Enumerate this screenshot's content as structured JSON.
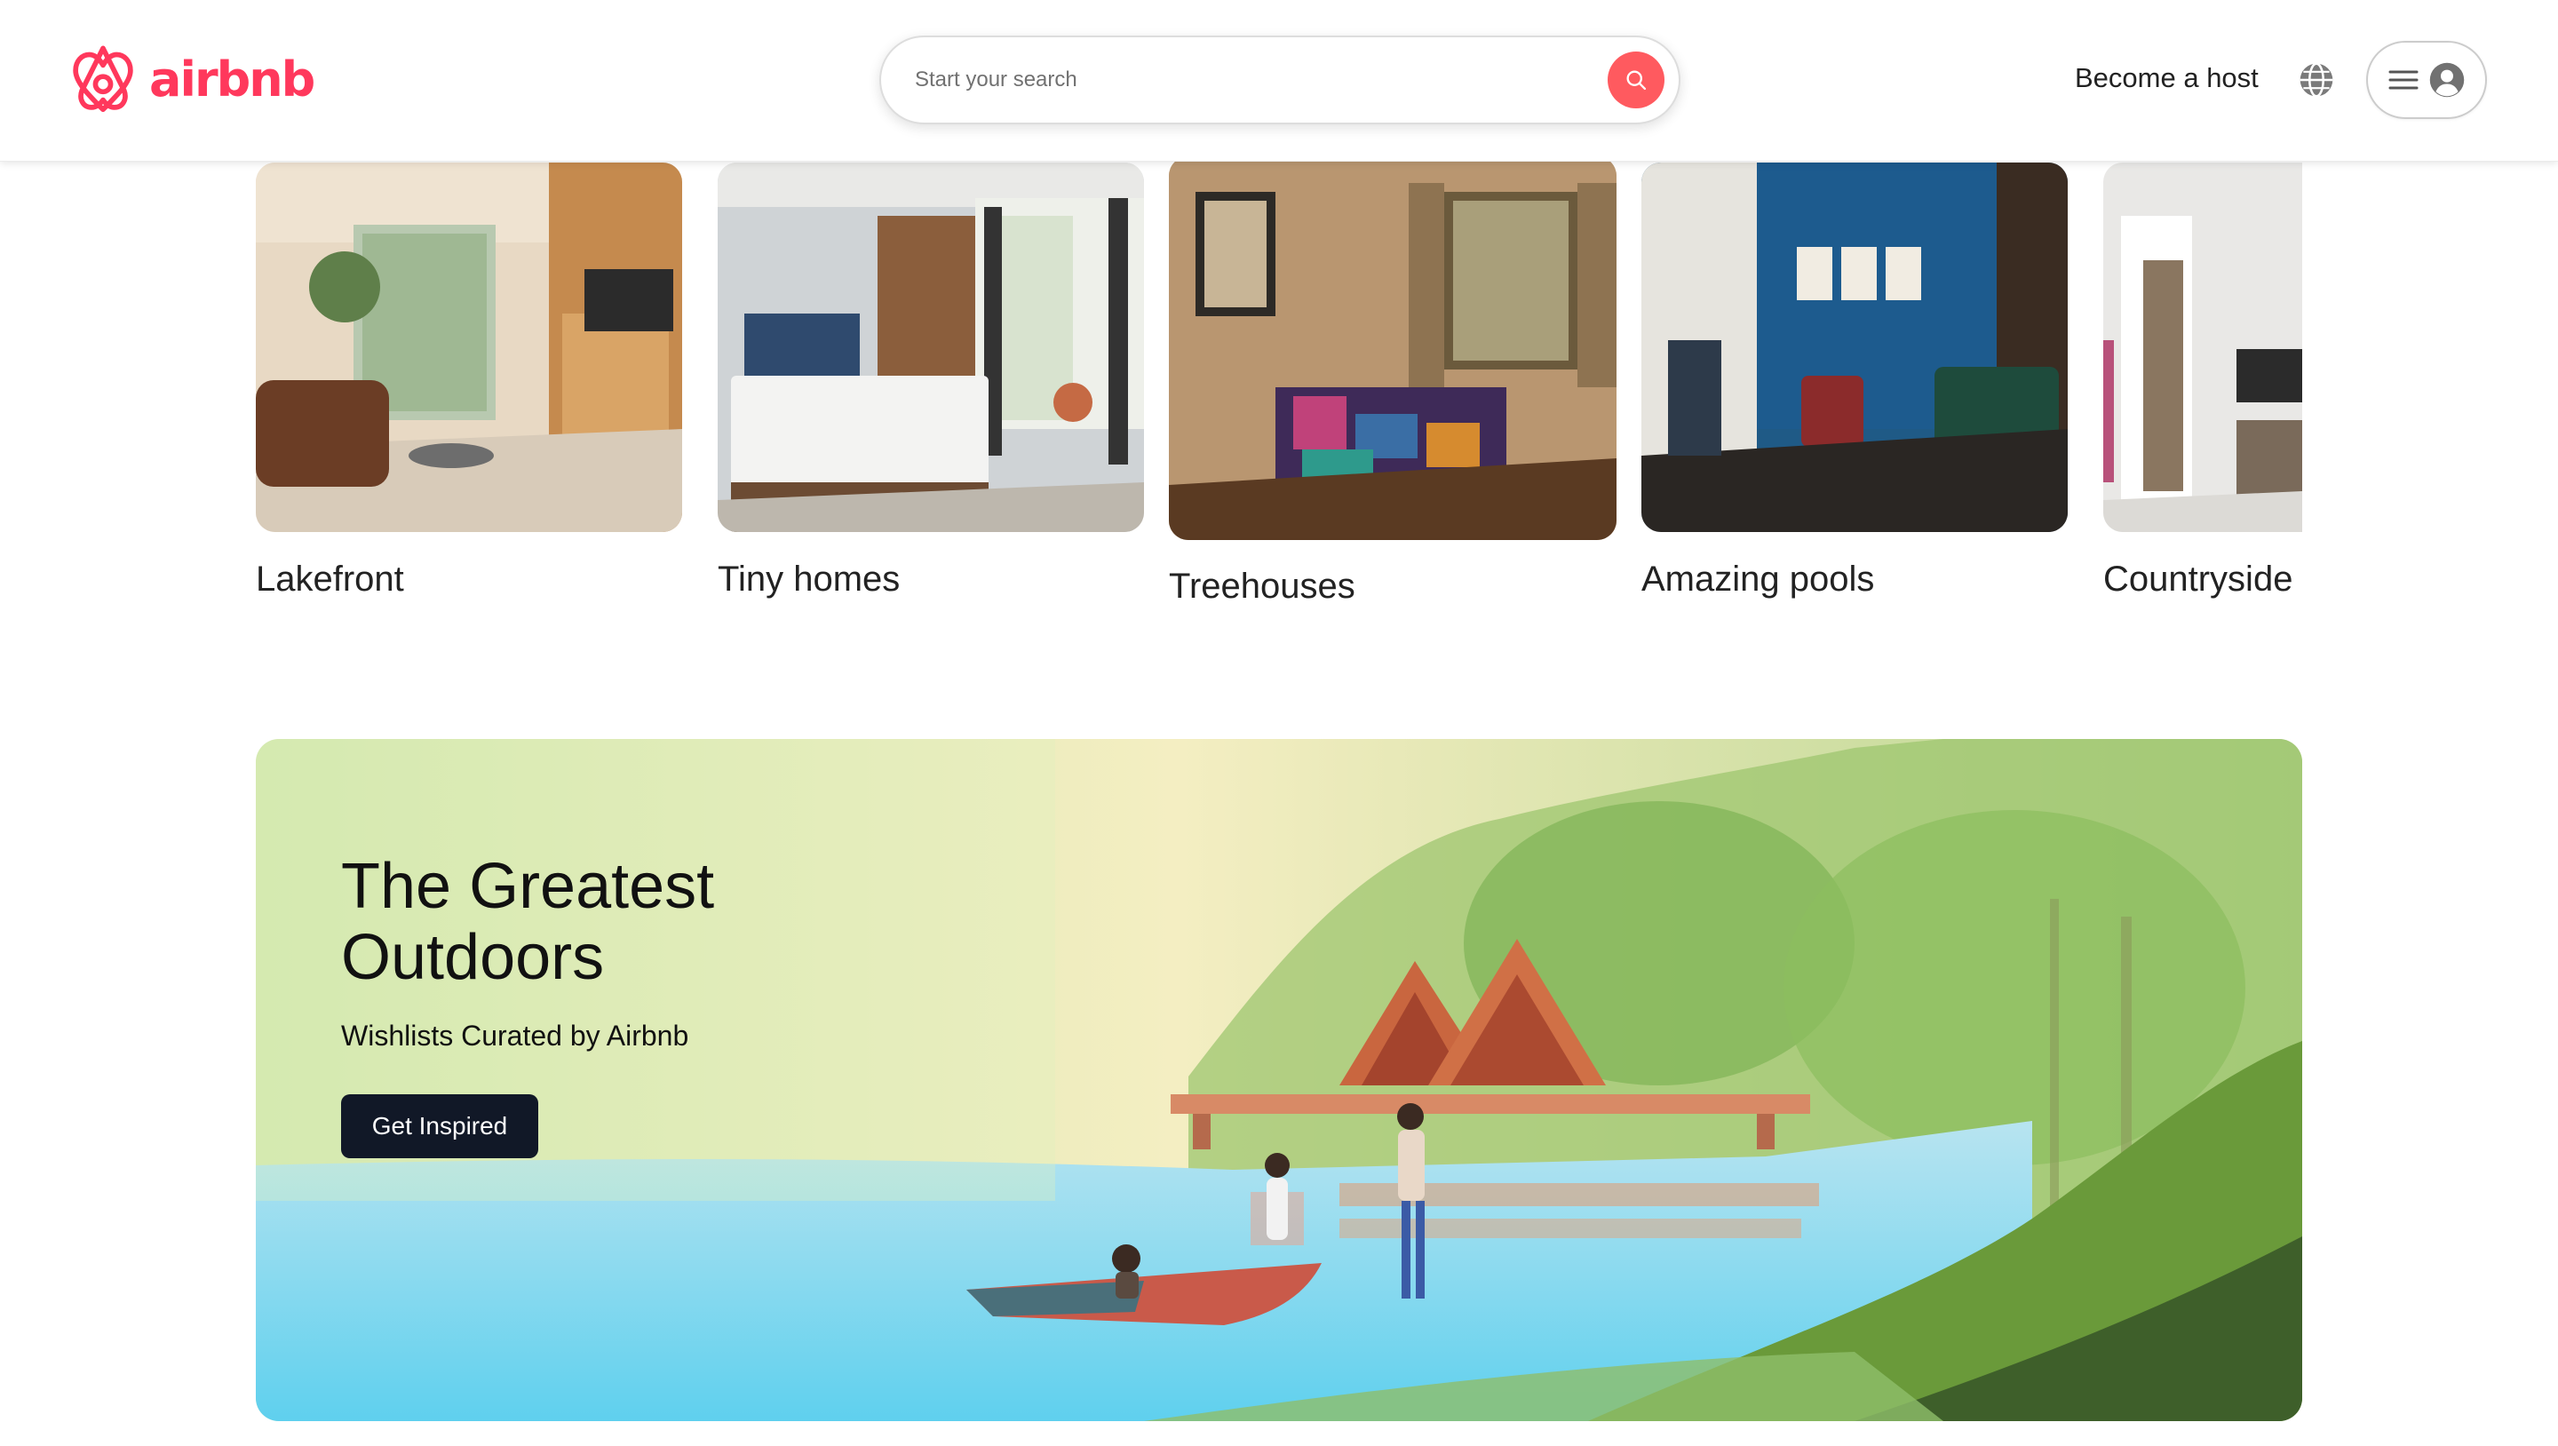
{
  "brand": {
    "name": "airbnb",
    "color": "#ff385c"
  },
  "search": {
    "placeholder": "Start your search",
    "button_color": "#ff5a5f"
  },
  "nav": {
    "become_host": "Become a host"
  },
  "icons": {
    "logo": "airbnb-belo-icon",
    "search": "search-icon",
    "globe": "globe-icon",
    "menu": "hamburger-icon",
    "profile": "user-avatar-icon"
  },
  "categories": [
    {
      "label": "Lakefront"
    },
    {
      "label": "Tiny homes"
    },
    {
      "label": "Treehouses"
    },
    {
      "label": "Amazing pools"
    },
    {
      "label": "Countryside"
    }
  ],
  "banner": {
    "title": "The Greatest Outdoors",
    "subtitle": "Wishlists Curated by Airbnb",
    "cta": "Get Inspired"
  }
}
